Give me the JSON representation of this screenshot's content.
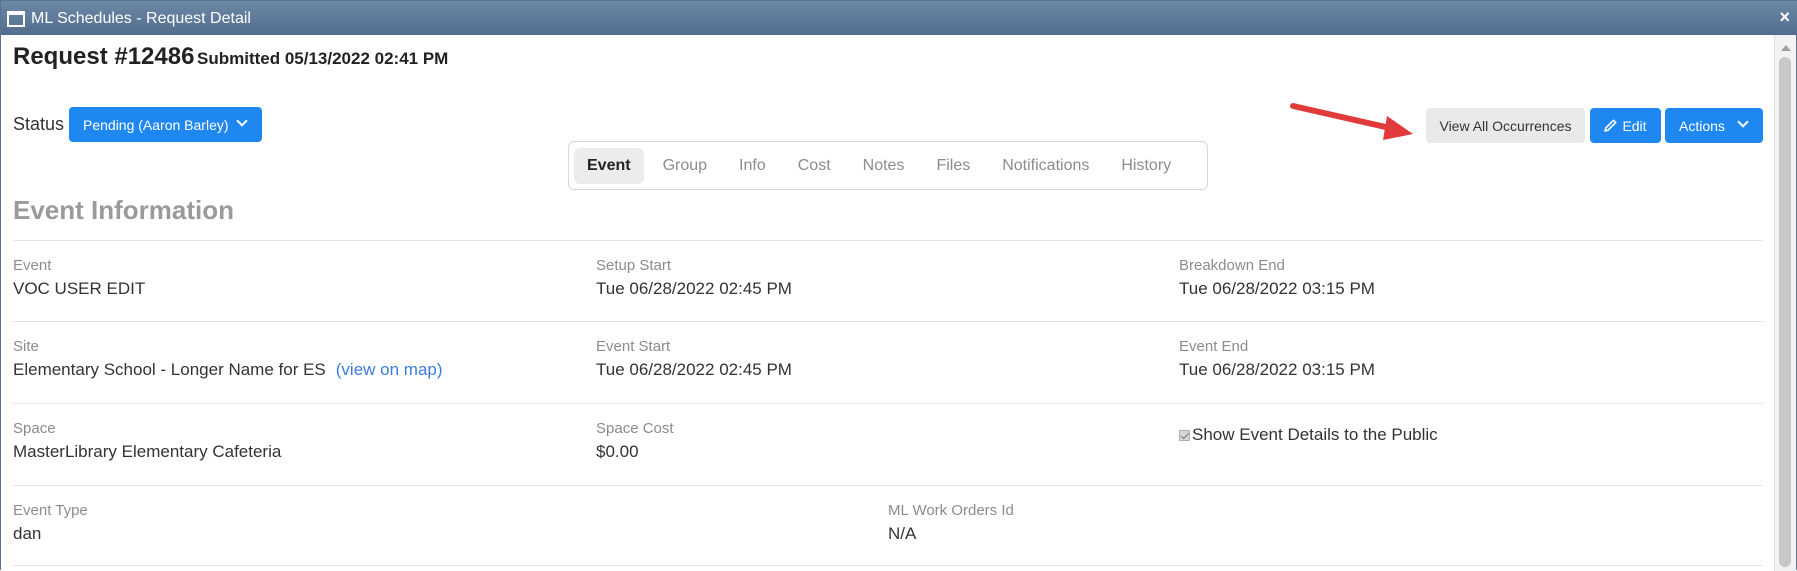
{
  "window": {
    "title": "ML Schedules - Request Detail",
    "close_label": "×"
  },
  "header": {
    "request_title": "Request #12486",
    "submitted": "Submitted 05/13/2022 02:41 PM"
  },
  "status": {
    "label": "Status",
    "value": "Pending (Aaron Barley)"
  },
  "toolbar": {
    "view_all_label": "View All Occurrences",
    "edit_label": "Edit",
    "actions_label": "Actions"
  },
  "tabs": [
    {
      "label": "Event",
      "active": true
    },
    {
      "label": "Group"
    },
    {
      "label": "Info"
    },
    {
      "label": "Cost"
    },
    {
      "label": "Notes"
    },
    {
      "label": "Files"
    },
    {
      "label": "Notifications"
    },
    {
      "label": "History"
    }
  ],
  "section_title": "Event Information",
  "fields": {
    "event": {
      "label": "Event",
      "value": "VOC USER EDIT"
    },
    "setup_start": {
      "label": "Setup Start",
      "value": "Tue 06/28/2022 02:45 PM"
    },
    "breakdown_end": {
      "label": "Breakdown End",
      "value": "Tue 06/28/2022 03:15 PM"
    },
    "site": {
      "label": "Site",
      "value": "Elementary School - Longer Name for ES",
      "link": "(view on map)"
    },
    "event_start": {
      "label": "Event Start",
      "value": "Tue 06/28/2022 02:45 PM"
    },
    "event_end": {
      "label": "Event End",
      "value": "Tue 06/28/2022 03:15 PM"
    },
    "space": {
      "label": "Space",
      "value": "MasterLibrary Elementary Cafeteria"
    },
    "space_cost": {
      "label": "Space Cost",
      "value": "$0.00"
    },
    "show_public": {
      "label": "Show Event Details to the Public",
      "checked": true
    },
    "event_type": {
      "label": "Event Type",
      "value": "dan"
    },
    "work_orders": {
      "label": "ML Work Orders Id",
      "value": "N/A"
    }
  },
  "colors": {
    "primary": "#1e87f0",
    "titlebar": "#5f7a9b",
    "annotation_arrow": "#e03a3a"
  },
  "icons": {
    "edit": "pencil-icon",
    "window": "window-icon",
    "dropdown": "chevron-down-icon"
  }
}
